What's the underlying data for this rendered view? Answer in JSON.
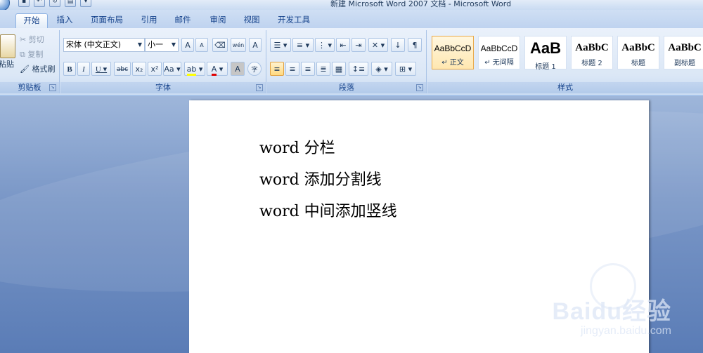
{
  "window": {
    "title": "新建 Microsoft Word 2007 文档 - Microsoft Word"
  },
  "quick_access": [
    "save-icon",
    "undo-icon",
    "redo-icon",
    "print-preview-icon",
    "customize-icon"
  ],
  "tabs": [
    {
      "label": "开始",
      "active": true
    },
    {
      "label": "插入"
    },
    {
      "label": "页面布局"
    },
    {
      "label": "引用"
    },
    {
      "label": "邮件"
    },
    {
      "label": "审阅"
    },
    {
      "label": "视图"
    },
    {
      "label": "开发工具"
    }
  ],
  "clipboard": {
    "paste_label": "粘贴",
    "cut_label": "剪切",
    "copy_label": "复制",
    "format_painter_label": "格式刷",
    "group_label": "剪贴板"
  },
  "font": {
    "font_name": "宋体 (中文正文)",
    "font_size": "小一",
    "grow_label": "A",
    "shrink_label": "A",
    "phonetic_label": "wén",
    "border_label": "A",
    "bold_label": "B",
    "italic_label": "I",
    "underline_label": "U",
    "strike_label": "abc",
    "subscript_label": "x₂",
    "superscript_label": "x²",
    "case_label": "Aa",
    "highlight_label": "ab",
    "color_label": "A",
    "shade_label": "A",
    "enclose_label": "字",
    "group_label": "字体"
  },
  "paragraph": {
    "group_label": "段落"
  },
  "styles": {
    "group_label": "样式",
    "items": [
      {
        "sample": "AaBbCcD",
        "name": "↵ 正文",
        "selected": true
      },
      {
        "sample": "AaBbCcD",
        "name": "↵ 无间隔"
      },
      {
        "sample": "AaB",
        "name": "标题 1"
      },
      {
        "sample": "AaBbC",
        "name": "标题 2"
      },
      {
        "sample": "AaBbC",
        "name": "标题"
      },
      {
        "sample": "AaBbC",
        "name": "副标题"
      }
    ]
  },
  "document": {
    "lines": [
      "word 分栏",
      "word 添加分割线",
      "word 中间添加竖线"
    ]
  },
  "watermark": {
    "main": "Baidu经验",
    "sub": "jingyan.baidu.com"
  },
  "colors": {
    "accent": "#15428b",
    "workspace": "#6f8fc4"
  }
}
